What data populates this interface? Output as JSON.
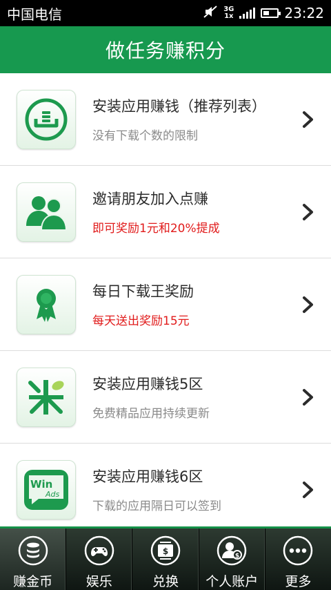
{
  "status_bar": {
    "carrier": "中国电信",
    "network": [
      "3G",
      "1x"
    ],
    "time": "23:22"
  },
  "header": {
    "title": "做任务赚积分"
  },
  "tasks": [
    {
      "title": "安装应用赚钱（推荐列表）",
      "subtitle": "没有下载个数的限制",
      "subtitle_color": "gray",
      "icon": "download-tray-icon"
    },
    {
      "title": "邀请朋友加入点赚",
      "subtitle": "即可奖励1元和20%提成",
      "subtitle_color": "red",
      "icon": "friends-icon"
    },
    {
      "title": "每日下载王奖励",
      "subtitle": "每天送出奖励15元",
      "subtitle_color": "red",
      "icon": "award-ribbon-icon"
    },
    {
      "title": "安装应用赚钱5区",
      "subtitle": "免费精品应用持续更新",
      "subtitle_color": "gray",
      "icon": "mi-logo-icon"
    },
    {
      "title": "安装应用赚钱6区",
      "subtitle": "下载的应用隔日可以签到",
      "subtitle_color": "gray",
      "icon": "winads-logo-icon",
      "logo_text": [
        "Win",
        "Ads"
      ]
    }
  ],
  "bottom_nav": [
    {
      "label": "赚金币",
      "icon": "coin-stack-icon",
      "active": true
    },
    {
      "label": "娱乐",
      "icon": "gamepad-icon",
      "active": false
    },
    {
      "label": "兑换",
      "icon": "exchange-icon",
      "active": false
    },
    {
      "label": "个人账户",
      "icon": "account-icon",
      "active": false
    },
    {
      "label": "更多",
      "icon": "more-icon",
      "active": false
    }
  ],
  "colors": {
    "brand_green": "#17994f",
    "highlight_red": "#e11b1b"
  }
}
